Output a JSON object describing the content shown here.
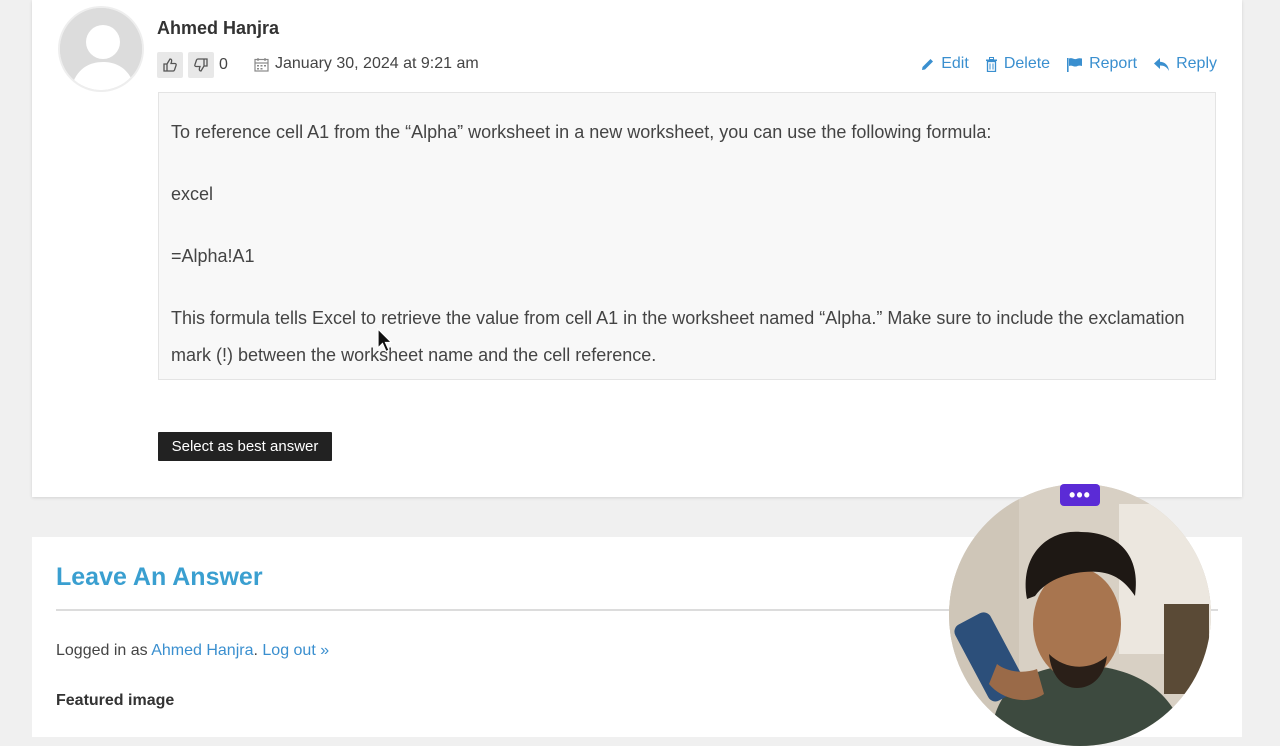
{
  "answer": {
    "author": "Ahmed Hanjra",
    "vote_count": "0",
    "date": "January 30, 2024 at 9:21 am",
    "actions": {
      "edit": "Edit",
      "delete": "Delete",
      "report": "Report",
      "reply": "Reply"
    },
    "content": {
      "p1": "To reference cell A1 from the “Alpha” worksheet in a new worksheet, you can use the following formula:",
      "p2": "excel",
      "p3": "=Alpha!A1",
      "p4": "This formula tells Excel to retrieve the value from cell A1 in the worksheet named “Alpha.” Make sure to include the exclamation mark (!) between the worksheet name and the cell reference."
    },
    "best_answer_label": "Select as best answer"
  },
  "answer_form": {
    "title": "Leave An Answer",
    "logged_prefix": "Logged in as ",
    "logged_user": "Ahmed Hanjra",
    "logged_sep": ".",
    "logout_label": "Log out »",
    "featured_image_label": "Featured image"
  },
  "webcam": {
    "menu_label": "•••"
  },
  "colors": {
    "link": "#3a8fcf",
    "title": "#3a9fd0",
    "button_bg": "#222222",
    "webcam_menu": "#5b2bd6"
  }
}
